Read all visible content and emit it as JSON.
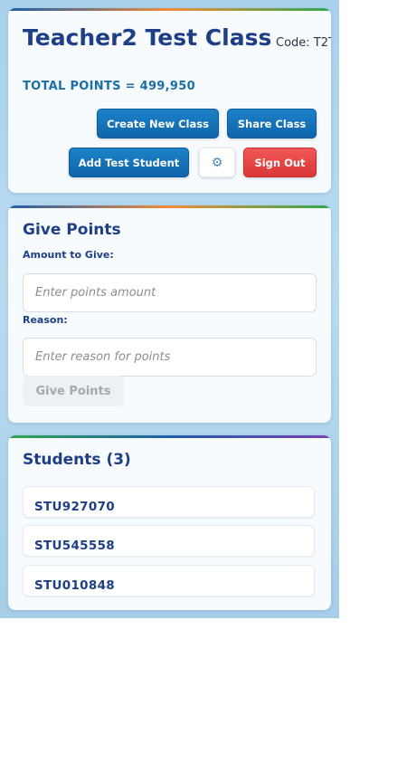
{
  "header": {
    "title": "Teacher2 Test Class",
    "code_text": "Code: T2T",
    "total_points_text": "TOTAL POINTS = 499,950",
    "buttons": {
      "create_new_class": "Create New Class",
      "share_class": "Share Class",
      "add_test_student": "Add Test Student",
      "settings_icon": "gear-icon",
      "sign_out": "Sign Out"
    }
  },
  "give_points": {
    "title": "Give Points",
    "amount_label": "Amount to Give:",
    "amount_placeholder": "Enter points amount",
    "amount_value": "",
    "reason_label": "Reason:",
    "reason_placeholder": "Enter reason for points",
    "reason_value": "",
    "submit_label": "Give Points",
    "submit_enabled": false
  },
  "students": {
    "title": "Students (3)",
    "items": [
      {
        "id": "STU927070"
      },
      {
        "id": "STU545558"
      },
      {
        "id": "STU010848"
      }
    ]
  },
  "colors": {
    "primary_blue": "#1e3f86",
    "button_blue": "#1273b8",
    "danger_red": "#e24343",
    "points_blue": "#1b6fa8"
  }
}
